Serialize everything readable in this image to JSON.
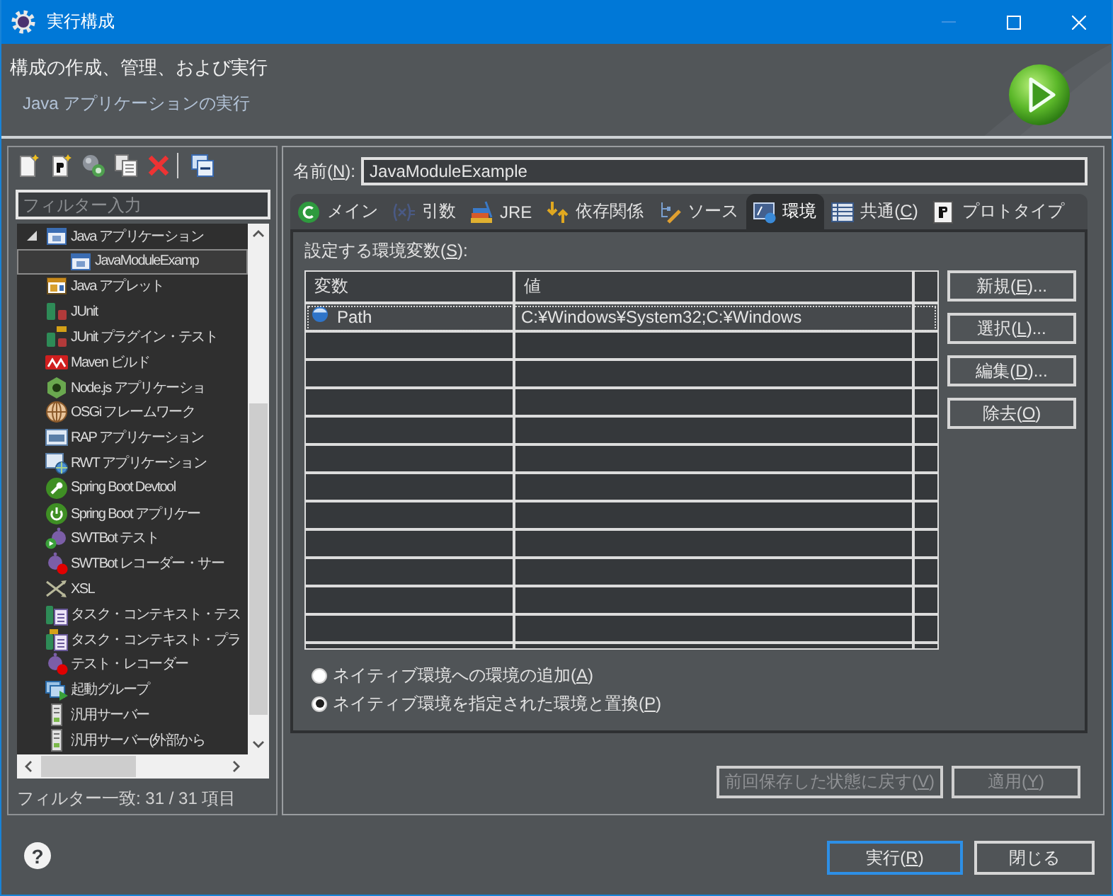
{
  "window": {
    "title": "実行構成",
    "controls": [
      {
        "kind": "minimize",
        "disabled": true
      },
      {
        "kind": "maximize",
        "disabled": false
      },
      {
        "kind": "close",
        "disabled": false
      }
    ]
  },
  "header": {
    "title": "構成の作成、管理、および実行",
    "subtitle": "Java アプリケーションの実行"
  },
  "sidebar": {
    "filter": {
      "placeholder": "フィルター入力"
    },
    "tree": [
      {
        "label": "Java アプリケーション",
        "kind": "javaapp",
        "expanded": true,
        "selected": false,
        "children": [
          {
            "label": "JavaModuleExamp",
            "kind": "javaapp",
            "selected": true
          }
        ]
      },
      {
        "label": "Java アプレット",
        "kind": "applet",
        "selected": false
      },
      {
        "label": "JUnit",
        "kind": "junit",
        "selected": false
      },
      {
        "label": "JUnit プラグイン・テスト",
        "kind": "junitplugin",
        "selected": false
      },
      {
        "label": "Maven ビルド",
        "kind": "maven",
        "selected": false
      },
      {
        "label": "Node.js アプリケーショ",
        "kind": "node",
        "selected": false
      },
      {
        "label": "OSGi フレームワーク",
        "kind": "osgi",
        "selected": false
      },
      {
        "label": "RAP アプリケーション",
        "kind": "rap",
        "selected": false
      },
      {
        "label": "RWT アプリケーション",
        "kind": "rwt",
        "selected": false
      },
      {
        "label": "Spring Boot Devtool",
        "kind": "devtools",
        "selected": false
      },
      {
        "label": "Spring Boot アプリケー",
        "kind": "springboot",
        "selected": false
      },
      {
        "label": "SWTBot テスト",
        "kind": "swtbot",
        "selected": false
      },
      {
        "label": "SWTBot レコーダー・サー",
        "kind": "recorder",
        "selected": false
      },
      {
        "label": "XSL",
        "kind": "xsl",
        "selected": false
      },
      {
        "label": "タスク・コンテキスト・テス",
        "kind": "tasktest",
        "selected": false
      },
      {
        "label": "タスク・コンテキスト・プラ",
        "kind": "taskplugin",
        "selected": false
      },
      {
        "label": "テスト・レコーダー",
        "kind": "recorder",
        "selected": false
      },
      {
        "label": "起動グループ",
        "kind": "group",
        "selected": false
      },
      {
        "label": "汎用サーバー",
        "kind": "server",
        "selected": false
      },
      {
        "label": "汎用サーバー(外部から",
        "kind": "server",
        "selected": false
      }
    ],
    "status": "フィルター一致: 31 / 31 項目"
  },
  "name_field": {
    "label": "名前(N):",
    "value": "JavaModuleExample"
  },
  "tabs": [
    {
      "label": "メイン",
      "kind": "main",
      "selected": false
    },
    {
      "label": "引数",
      "kind": "arguments",
      "selected": false
    },
    {
      "label": "JRE",
      "kind": "jre",
      "selected": false
    },
    {
      "label": "依存関係",
      "kind": "dependencies",
      "selected": false
    },
    {
      "label": "ソース",
      "kind": "source",
      "selected": false
    },
    {
      "label": "環境",
      "kind": "environment",
      "selected": true
    },
    {
      "label": "共通(C)",
      "kind": "common",
      "selected": false
    },
    {
      "label": "プロトタイプ",
      "kind": "prototype",
      "selected": false
    }
  ],
  "environment": {
    "label": "設定する環境変数(S):",
    "table": {
      "columns": [
        "変数",
        "値"
      ],
      "rows": [
        {
          "cells": [
            "Path",
            "C:¥Windows¥System32;C:¥Windows"
          ],
          "selected": true
        }
      ]
    },
    "buttons": [
      "新規(E)...",
      "選択(L)...",
      "編集(D)...",
      "除去(O)"
    ],
    "options": [
      {
        "label": "ネイティブ環境への環境の追加(A)",
        "selected": false
      },
      {
        "label": "ネイティブ環境を指定された環境と置換(P)",
        "selected": true
      }
    ]
  },
  "tab_buttons": [
    {
      "label": "前回保存した状態に戻す(V)",
      "disabled": true
    },
    {
      "label": "適用(Y)",
      "disabled": true
    }
  ],
  "help": {
    "label": "?"
  },
  "dialog_buttons": [
    {
      "label": "実行(R)",
      "default": true
    },
    {
      "label": "閉じる",
      "default": false
    }
  ]
}
